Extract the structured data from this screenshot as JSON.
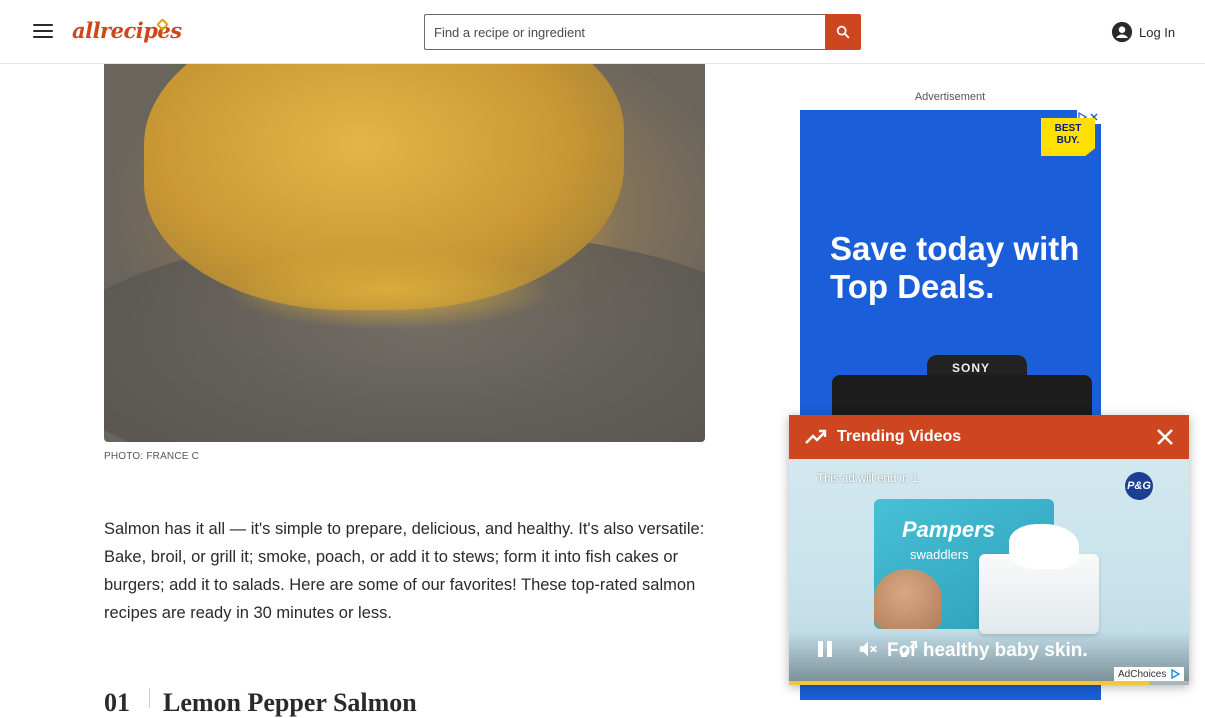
{
  "header": {
    "logo_text": "allrecipes",
    "search": {
      "placeholder": "Find a recipe or ingredient",
      "value": ""
    },
    "login_label": "Log In"
  },
  "article": {
    "photo_credit": "PHOTO: FRANCE C",
    "intro": "Salmon has it all — it's simple to prepare, delicious, and healthy. It's also versatile: Bake, broil, or grill it; smoke, poach, or add it to stews; form it into fish cakes or burgers; add it to salads. Here are some of our favorites! These top-rated salmon recipes are ready in 30 minutes or less.",
    "first_item": {
      "number": "01",
      "title": "Lemon Pepper Salmon"
    }
  },
  "sidebar_ad": {
    "label": "Advertisement",
    "brand_line1": "BEST",
    "brand_line2": "BUY.",
    "headline": "Save today with Top Deals.",
    "camera_brand": "SONY"
  },
  "trending": {
    "title": "Trending Videos",
    "video": {
      "ad_countdown": "This ad will end in 1",
      "sponsor_badge": "P&G",
      "product_brand": "Pampers",
      "product_name": "swaddlers",
      "tagline": "For healthy baby skin.",
      "adchoices_label": "AdChoices",
      "progress_fraction": 0.9
    }
  },
  "colors": {
    "brand": "#ce4620",
    "ad_blue": "#1a5fd9",
    "best_buy_yellow": "#ffe000"
  }
}
